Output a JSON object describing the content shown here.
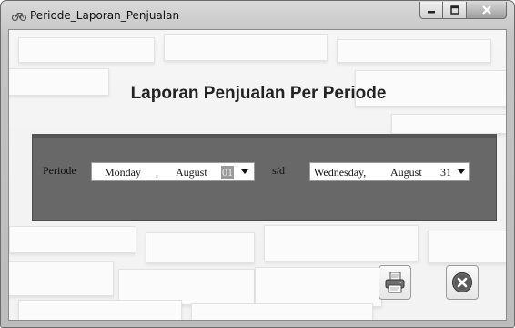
{
  "window": {
    "title": "Periode_Laporan_Penjualan"
  },
  "main": {
    "heading": "Laporan Penjualan Per Periode",
    "periode_label": "Periode",
    "separator_label": "s/d",
    "start_date": {
      "day_name": "Monday",
      "comma": ",",
      "month": "August",
      "day": "01"
    },
    "end_date": {
      "day_name": "Wednesday,",
      "month": "August",
      "day": "31"
    }
  },
  "buttons": {
    "print_icon": "printer-icon",
    "close_icon": "close-circle-icon"
  }
}
